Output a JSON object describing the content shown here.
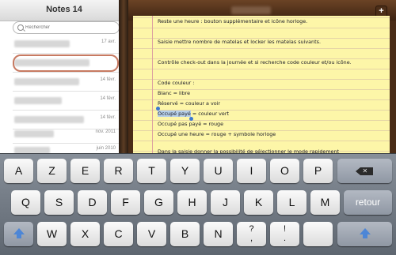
{
  "list": {
    "title": "Notes 14",
    "search_placeholder": "Rechercher",
    "notes": [
      {
        "date": "17 avr."
      },
      {
        "date": ""
      },
      {
        "date": "14 févr."
      },
      {
        "date": "14 févr."
      },
      {
        "date": "14 févr."
      },
      {
        "date": "nov. 2011"
      },
      {
        "date": "juin 2010"
      }
    ]
  },
  "note": {
    "add_label": "+",
    "lines": [
      {
        "text": "Reste une heure : bouton supplémentaire et icône horloge."
      },
      {
        "text": ""
      },
      {
        "text": "Saisie mettre nombre de matelas et locker les matelas suivants."
      },
      {
        "text": ""
      },
      {
        "text": "Contrôle check-out dans la journée et si recherche code couleur et/ou icône."
      },
      {
        "text": ""
      },
      {
        "text": "Code couleur :"
      },
      {
        "text": "Blanc = libre"
      },
      {
        "text": "Réservé = couleur a voir"
      },
      {
        "text_selected": "Occupé payé",
        "text_rest": " = couleur vert"
      },
      {
        "text": "Occupé pas payé = rouge"
      },
      {
        "text": "Occupé une heure = rouge + symbole horloge"
      },
      {
        "text": ""
      },
      {
        "text": "Dans la saisie donner la possibilité de sélectionner le mode rapidement"
      }
    ]
  },
  "keyboard": {
    "row1": [
      "A",
      "Z",
      "E",
      "R",
      "T",
      "Y",
      "U",
      "I",
      "O",
      "P"
    ],
    "row2": [
      "Q",
      "S",
      "D",
      "F",
      "G",
      "H",
      "J",
      "K",
      "L",
      "M"
    ],
    "row3": [
      "W",
      "X",
      "C",
      "V",
      "B",
      "N"
    ],
    "row3_punct": [
      {
        "top": "?",
        "bottom": ","
      },
      {
        "top": "!",
        "bottom": "."
      }
    ],
    "return_label": "retour",
    "icons": {
      "backspace": "backspace-icon",
      "shift": "shift-icon"
    }
  }
}
